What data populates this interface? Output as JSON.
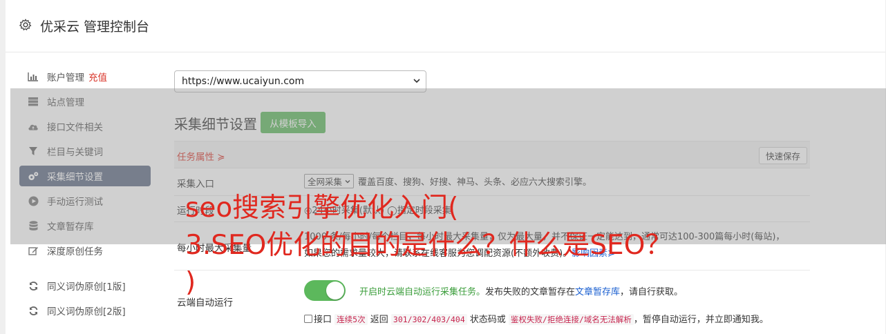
{
  "header": {
    "title": "优采云 管理控制台",
    "icon": "gear-icon"
  },
  "sidebar": {
    "items": [
      {
        "label": "账户管理",
        "extra": "充值",
        "icon": "bar-chart-icon"
      },
      {
        "label": "站点管理",
        "icon": "server-icon"
      },
      {
        "label": "接口文件相关",
        "icon": "cloud-upload-icon"
      },
      {
        "label": "栏目与关键词",
        "icon": "filter-icon"
      },
      {
        "label": "采集细节设置",
        "icon": "gears-icon",
        "active": true
      },
      {
        "label": "手动运行测试",
        "icon": "play-circle-icon"
      },
      {
        "label": "文章暂存库",
        "icon": "database-icon"
      },
      {
        "label": "深度原创任务",
        "icon": "edit-icon"
      },
      {
        "label": "同义词伪原创[1版]",
        "icon": "refresh-icon"
      },
      {
        "label": "同义词伪原创[2版]",
        "icon": "refresh-icon"
      }
    ]
  },
  "main": {
    "site_select": "https://www.ucaiyun.com",
    "section_title": "采集细节设置",
    "import_button": "从模板导入",
    "task_attr": "任务属性 ≽",
    "quick_save": "快速保存",
    "entry": {
      "label": "采集入口",
      "select": "全网采集",
      "desc": "覆盖百度、搜狗、好搜、神马、头条、必应六大搜索引擎。"
    },
    "run_row": {
      "label": "运行时段",
      "text": "◎24小时采集(默认) ◯指定时段采集"
    },
    "max_row": {
      "label": "每小时最大采集量",
      "line1": "1000 条/每小时/每个栏目，每小时最大采集量，仅为最大量，并不保证一定能达到，通常可达100-300篇每小时(每站)，",
      "line2_pre": "如果您的需求量较大，请联系在线客服为您调配资源(不额外收费)。",
      "line2_link": "影响因素≽"
    },
    "cloud_row": {
      "label": "云端自动运行",
      "toggle_on": true,
      "desc_green": "开启时云端自动运行采集任务。",
      "desc_mid": "发布失败的文章暂存在",
      "desc_link": "文章暂存库",
      "desc_end": "，请自行获取。",
      "checkbox_label": "接口",
      "code1": "连续5次",
      "t1": "返回",
      "code2": "301/302/403/404",
      "t2": "状态码或",
      "code3": "鉴权失败/拒绝连接/域名无法解析",
      "t3": "，暂停自动运行，并立即通知我。"
    }
  },
  "overlay": {
    "text": "seo搜索引擎优化入门(\n3.SEO优化的目的是什么？什么是SEO？\n)"
  },
  "colors": {
    "accent": "#5d6a84",
    "green": "#5cb85c",
    "red": "#d9352a",
    "link": "#1a5fd0"
  }
}
